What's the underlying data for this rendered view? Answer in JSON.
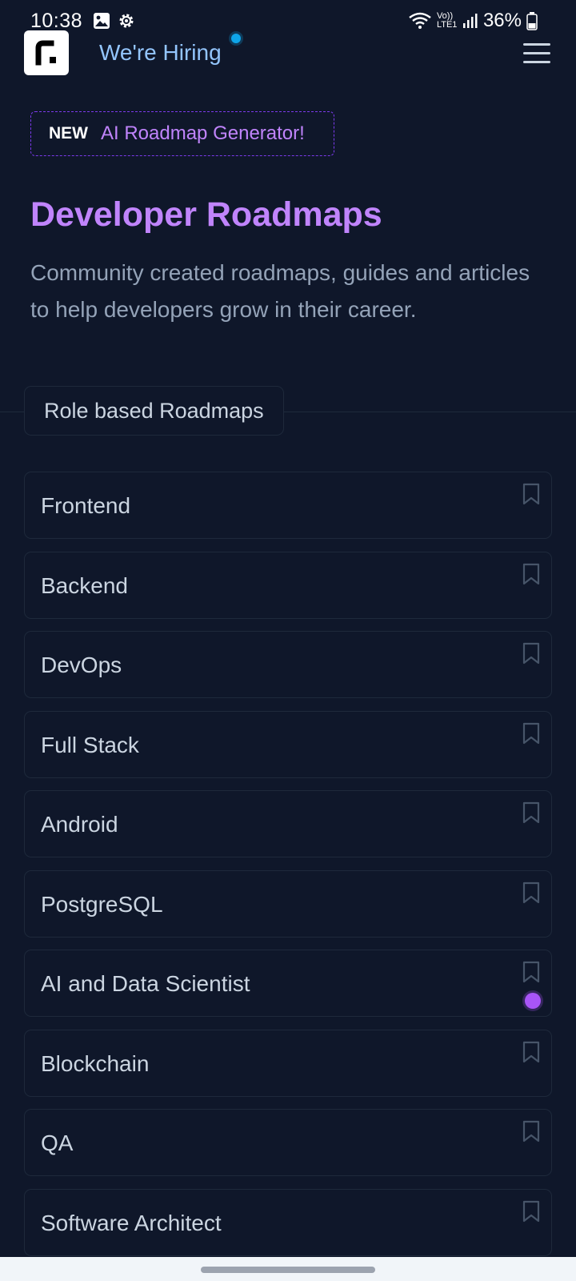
{
  "status_bar": {
    "time": "10:38",
    "network": "Vo)) LTE1",
    "battery": "36%",
    "icons": [
      "image-icon",
      "gear-icon",
      "wifi-icon",
      "signal-icon",
      "battery-icon"
    ]
  },
  "header": {
    "logo_icon": "roadmap-logo",
    "hiring_label": "We're Hiring",
    "menu_icon": "hamburger-menu-icon"
  },
  "promo": {
    "badge": "NEW",
    "text": "AI Roadmap Generator!"
  },
  "hero": {
    "title": "Developer Roadmaps",
    "subtitle": "Community created roadmaps, guides and articles to help developers grow in their career."
  },
  "section": {
    "label": "Role based Roadmaps"
  },
  "roadmaps": [
    {
      "label": "Frontend",
      "new": false
    },
    {
      "label": "Backend",
      "new": false
    },
    {
      "label": "DevOps",
      "new": false
    },
    {
      "label": "Full Stack",
      "new": false
    },
    {
      "label": "Android",
      "new": false
    },
    {
      "label": "PostgreSQL",
      "new": false
    },
    {
      "label": "AI and Data Scientist",
      "new": true
    },
    {
      "label": "Blockchain",
      "new": false
    },
    {
      "label": "QA",
      "new": false
    },
    {
      "label": "Software Architect",
      "new": false
    }
  ],
  "colors": {
    "background": "#0f172a",
    "accent_purple": "#c084fc",
    "hiring_blue": "#93c5fd",
    "dot_blue": "#0ea5e9",
    "new_dot": "#a855f7"
  }
}
